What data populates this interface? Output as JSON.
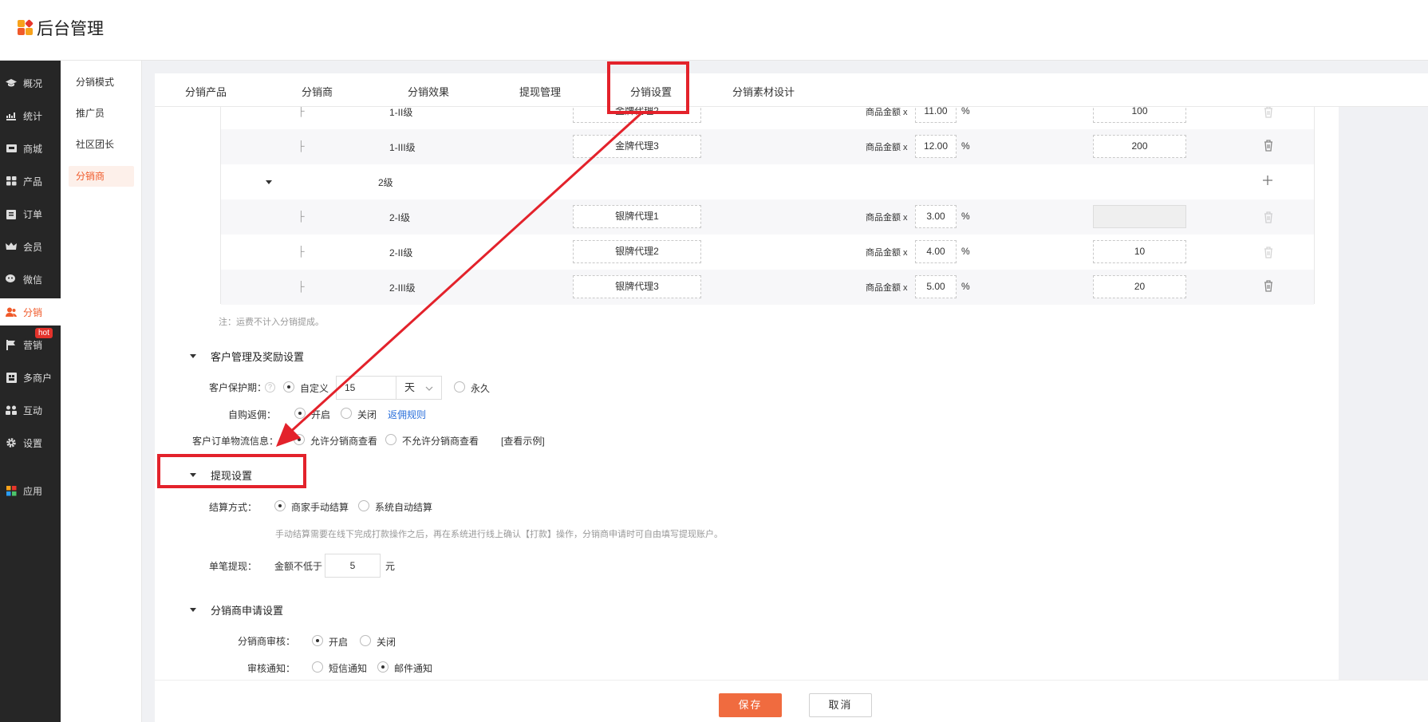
{
  "header": {
    "title": "后台管理"
  },
  "nav": {
    "items": [
      {
        "label": "概况",
        "icon": "graduation-cap-icon"
      },
      {
        "label": "统计",
        "icon": "chart-icon"
      },
      {
        "label": "商城",
        "icon": "store-icon"
      },
      {
        "label": "产品",
        "icon": "grid-icon"
      },
      {
        "label": "订单",
        "icon": "clipboard-icon"
      },
      {
        "label": "会员",
        "icon": "crown-icon"
      },
      {
        "label": "微信",
        "icon": "wechat-icon"
      },
      {
        "label": "分销",
        "icon": "users-icon"
      },
      {
        "label": "营销",
        "icon": "flag-icon"
      },
      {
        "label": "多商户",
        "icon": "shop-icon"
      },
      {
        "label": "互动",
        "icon": "people-icon"
      },
      {
        "label": "设置",
        "icon": "gear-icon"
      },
      {
        "label": "应用",
        "icon": "apps-icon"
      }
    ],
    "hot_badge": "hot"
  },
  "subnav": {
    "items": [
      "分销模式",
      "推广员",
      "社区团长",
      "分销商"
    ]
  },
  "tabs": [
    "分销产品",
    "分销商",
    "分销效果",
    "提现管理",
    "分销设置",
    "分销素材设计"
  ],
  "table": {
    "rows": [
      {
        "level": "1-II级",
        "name": "金牌代理2",
        "amount_label": "商品金额 x",
        "pct": "11.00",
        "unit": "%",
        "threshold": "100"
      },
      {
        "level": "1-III级",
        "name": "金牌代理3",
        "amount_label": "商品金额 x",
        "pct": "12.00",
        "unit": "%",
        "threshold": "200"
      },
      {
        "group": "2级"
      },
      {
        "level": "2-I级",
        "name": "银牌代理1",
        "amount_label": "商品金额 x",
        "pct": "3.00",
        "unit": "%",
        "threshold": ""
      },
      {
        "level": "2-II级",
        "name": "银牌代理2",
        "amount_label": "商品金额 x",
        "pct": "4.00",
        "unit": "%",
        "threshold": "10"
      },
      {
        "level": "2-III级",
        "name": "银牌代理3",
        "amount_label": "商品金额 x",
        "pct": "5.00",
        "unit": "%",
        "threshold": "20"
      }
    ],
    "branch_glyph": "├",
    "note": "注：运费不计入分销提成。"
  },
  "customer_section": {
    "title": "客户管理及奖励设置",
    "protection_label": "客户保护期：",
    "protection_help": "?",
    "opt_custom": "自定义",
    "days_value": "15",
    "days_unit": "天",
    "opt_forever": "永久",
    "self_buy_label": "自购返佣：",
    "opt_open": "开启",
    "opt_close": "关闭",
    "rebate_rule_link": "返佣规则",
    "logistics_label": "客户订单物流信息：",
    "opt_allow": "允许分销商查看",
    "opt_disallow": "不允许分销商查看",
    "example_link": "[查看示例]"
  },
  "withdraw_section": {
    "title": "提现设置",
    "settle_label": "结算方式：",
    "opt_manual": "商家手动结算",
    "opt_auto": "系统自动结算",
    "hint": "手动结算需要在线下完成打款操作之后，再在系统进行线上确认【打款】操作，分销商申请时可自由填写提现账户。",
    "single_label": "单笔提现：",
    "min_prefix": "金额不低于",
    "min_value": "5",
    "min_unit": "元"
  },
  "apply_section": {
    "title": "分销商申请设置",
    "review_label": "分销商审核：",
    "opt_open": "开启",
    "opt_close": "关闭",
    "notify_label": "审核通知：",
    "opt_sms": "短信通知",
    "opt_mail": "邮件通知"
  },
  "footer": {
    "save": "保存",
    "cancel": "取消"
  },
  "colors": {
    "accent": "#f05a2a",
    "annotation": "#e3222b",
    "nav_bg": "#262626"
  }
}
